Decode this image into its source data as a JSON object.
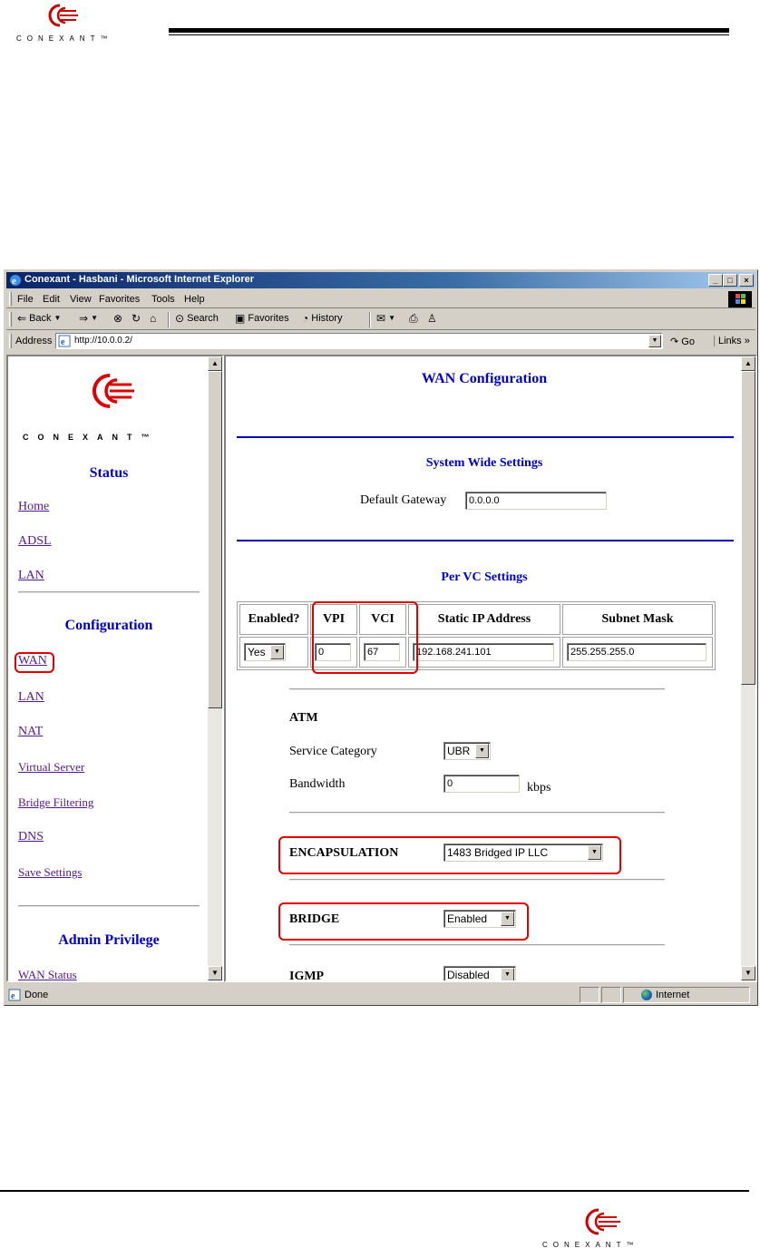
{
  "doc": {
    "logo_word": "CONEXANT™"
  },
  "window": {
    "title": "Conexant - Hasbani - Microsoft Internet Explorer",
    "caption_buttons": [
      "_",
      "□",
      "×"
    ]
  },
  "menu": [
    "File",
    "Edit",
    "View",
    "Favorites",
    "Tools",
    "Help"
  ],
  "toolbar": {
    "back": "Back",
    "search": "Search",
    "favorites": "Favorites",
    "history": "History"
  },
  "address": {
    "label": "Address",
    "url": "http://10.0.0.2/",
    "go": "Go",
    "links": "Links »"
  },
  "sidebar": {
    "logo_word": "CONEXANT™",
    "status_heading": "Status",
    "status_links": [
      "Home",
      "ADSL",
      "LAN"
    ],
    "config_heading": "Configuration",
    "config_links": [
      "WAN",
      "LAN",
      "NAT",
      "Virtual Server",
      "Bridge Filtering",
      "DNS",
      "Save Settings"
    ],
    "admin_heading": "Admin Privilege",
    "admin_links": [
      "WAN Status"
    ]
  },
  "main": {
    "title": "WAN Configuration",
    "system_heading": "System Wide Settings",
    "default_gateway_label": "Default Gateway",
    "default_gateway_value": "0.0.0.0",
    "per_vc_heading": "Per VC Settings",
    "vc_columns": [
      "Enabled?",
      "VPI",
      "VCI",
      "Static IP Address",
      "Subnet Mask"
    ],
    "vc_row": {
      "enabled": "Yes",
      "vpi": "0",
      "vci": "67",
      "static_ip": "192.168.241.101",
      "subnet_mask": "255.255.255.0"
    },
    "atm_heading": "ATM",
    "service_category_label": "Service Category",
    "service_category_value": "UBR",
    "bandwidth_label": "Bandwidth",
    "bandwidth_value": "0",
    "bandwidth_unit": "kbps",
    "encapsulation_label": "ENCAPSULATION",
    "encapsulation_value": "1483 Bridged IP LLC",
    "bridge_label": "BRIDGE",
    "bridge_value": "Enabled",
    "igmp_label": "IGMP",
    "igmp_value": "Disabled"
  },
  "status": {
    "text": "Done",
    "zone": "Internet"
  },
  "colors": {
    "heading_blue": "#0000cc",
    "highlight_red": "#e00000",
    "titlebar": "#0a246a"
  }
}
